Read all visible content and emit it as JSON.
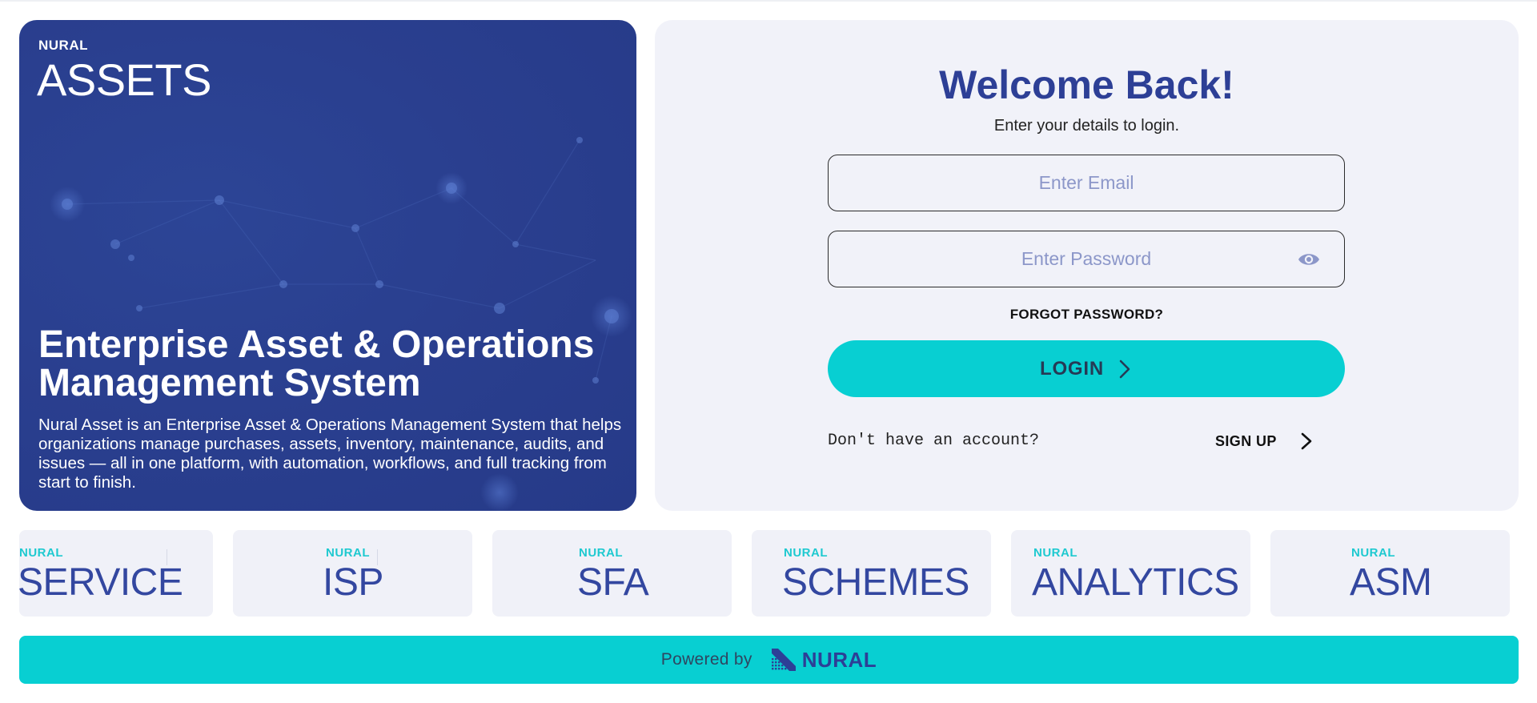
{
  "hero": {
    "brand_small": "NURAL",
    "brand_big": "ASSETS",
    "title": "Enterprise Asset & Operations Management System",
    "description": "Nural Asset is an Enterprise Asset & Operations Management System that helps organizations manage purchases, assets, inventory, maintenance, audits, and issues — all in one platform, with automation, workflows, and full tracking from start to finish."
  },
  "login": {
    "welcome": "Welcome Back!",
    "subtitle": "Enter your details to login.",
    "email_placeholder": "Enter Email",
    "email_value": "",
    "password_placeholder": "Enter Password",
    "password_value": "",
    "forgot_label": "FORGOT PASSWORD?",
    "login_label": "LOGIN",
    "no_account_text": "Don't have an account?",
    "signup_label": "SIGN UP"
  },
  "products": [
    {
      "brand": "NURAL",
      "name": "SERVICE"
    },
    {
      "brand": "NURAL",
      "name": "ISP"
    },
    {
      "brand": "NURAL",
      "name": "SFA"
    },
    {
      "brand": "NURAL",
      "name": "SCHEMES"
    },
    {
      "brand": "NURAL",
      "name": "ANALYTICS"
    },
    {
      "brand": "NURAL",
      "name": "ASM"
    }
  ],
  "footer": {
    "powered_by": "Powered by",
    "logo_text": "NURAL"
  },
  "colors": {
    "hero_blue": "#2a3f8f",
    "accent_teal": "#08cfd2",
    "heading_blue": "#2d3f96",
    "panel_bg": "#f1f2f9"
  }
}
